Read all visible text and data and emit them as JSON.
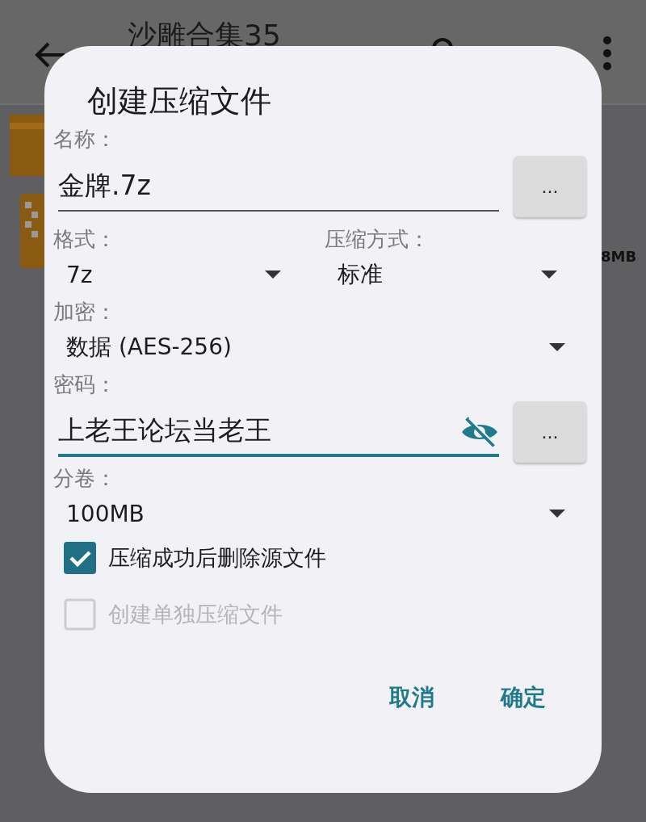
{
  "app_bar": {
    "title": "沙雕合集35"
  },
  "file_list": {
    "size_fragment": "8MB"
  },
  "dialog": {
    "title": "创建压缩文件",
    "name": {
      "label": "名称：",
      "value": "金牌.7z",
      "browse": "..."
    },
    "format": {
      "label": "格式：",
      "value": "7z"
    },
    "method": {
      "label": "压缩方式：",
      "value": "标准"
    },
    "encryption": {
      "label": "加密：",
      "value": "数据 (AES-256)"
    },
    "password": {
      "label": "密码：",
      "value": "上老王论坛当老王",
      "visible": true,
      "focused": true,
      "browse": "..."
    },
    "volume": {
      "label": "分卷：",
      "value": "100MB"
    },
    "options": [
      {
        "label": "压缩成功后删除源文件",
        "checked": true,
        "disabled": false
      },
      {
        "label": "创建单独压缩文件",
        "checked": false,
        "disabled": true
      }
    ],
    "buttons": [
      {
        "label": "取消"
      },
      {
        "label": "确定"
      }
    ]
  }
}
